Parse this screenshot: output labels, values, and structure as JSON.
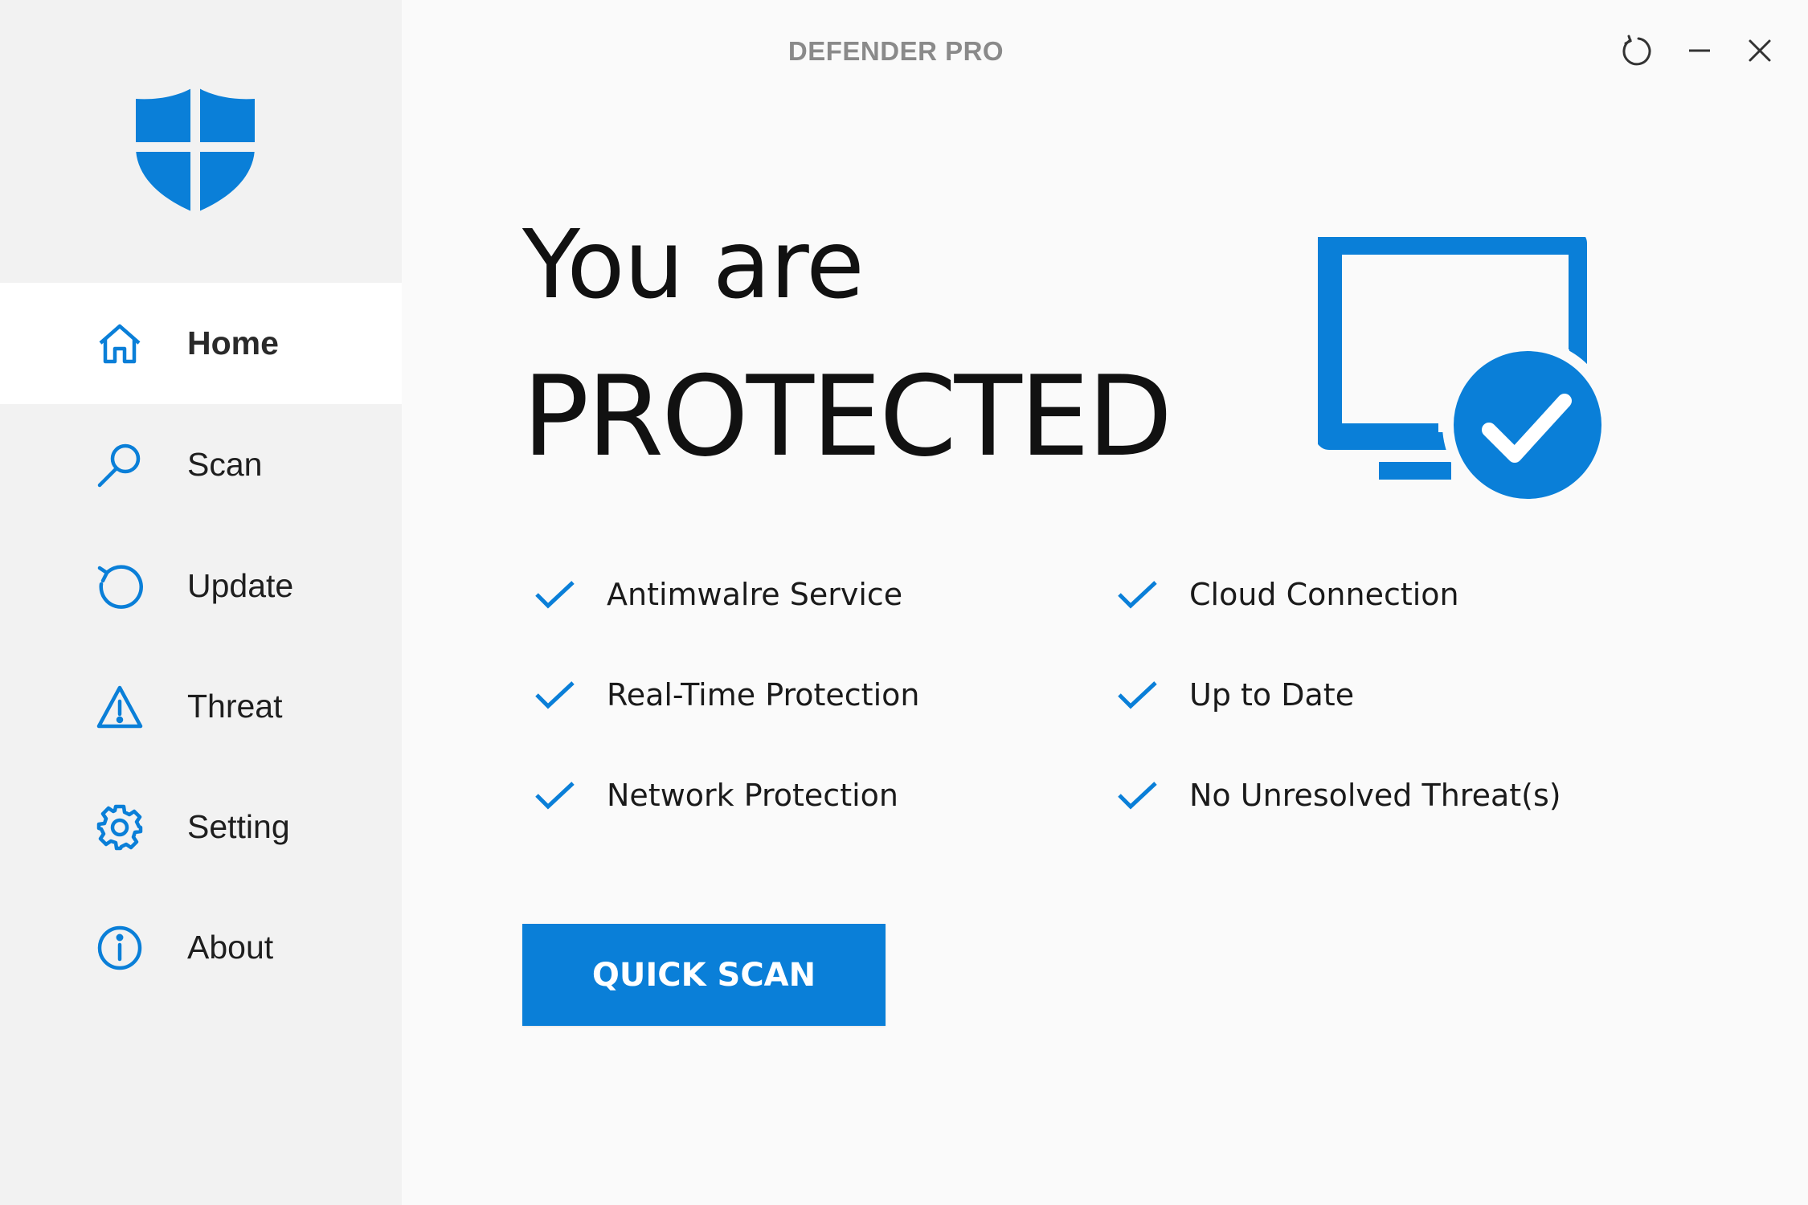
{
  "app": {
    "title": "DEFENDER PRO"
  },
  "window_controls": {
    "refresh_icon": "refresh-icon",
    "minimize_icon": "minimize-icon",
    "close_icon": "close-icon"
  },
  "sidebar": {
    "logo_icon": "shield-logo-icon",
    "items": [
      {
        "label": "Home",
        "icon": "home-icon",
        "active": true
      },
      {
        "label": "Scan",
        "icon": "search-icon",
        "active": false
      },
      {
        "label": "Update",
        "icon": "update-icon",
        "active": false
      },
      {
        "label": "Threat",
        "icon": "warning-icon",
        "active": false
      },
      {
        "label": "Setting",
        "icon": "gear-icon",
        "active": false
      },
      {
        "label": "About",
        "icon": "info-icon",
        "active": false
      }
    ]
  },
  "main": {
    "headline_line1": "You are",
    "headline_line2": "PROTECTED",
    "status_icon": "monitor-check-icon",
    "status_items": [
      {
        "label": "Antimwalre Service"
      },
      {
        "label": "Real-Time Protection"
      },
      {
        "label": "Network Protection"
      },
      {
        "label": "Cloud Connection"
      },
      {
        "label": "Up to Date"
      },
      {
        "label": "No Unresolved Threat(s)"
      }
    ],
    "quick_scan_label": "QUICK SCAN"
  },
  "colors": {
    "accent": "#0a7fd8",
    "sidebar_bg": "#f2f2f2",
    "main_bg": "#fafafa"
  }
}
